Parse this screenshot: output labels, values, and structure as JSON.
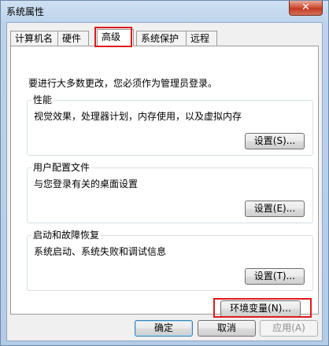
{
  "window": {
    "title": "系统属性",
    "close_glyph": "✕"
  },
  "tabs": [
    {
      "label": "计算机名"
    },
    {
      "label": "硬件"
    },
    {
      "label": "高级"
    },
    {
      "label": "系统保护"
    },
    {
      "label": "远程"
    }
  ],
  "intro": "要进行大多数更改，您必须作为管理员登录。",
  "groups": {
    "performance": {
      "title": "性能",
      "desc": "视觉效果，处理器计划，内存使用，以及虚拟内存",
      "button": "设置(S)..."
    },
    "profiles": {
      "title": "用户配置文件",
      "desc": "与您登录有关的桌面设置",
      "button": "设置(E)..."
    },
    "startup": {
      "title": "启动和故障恢复",
      "desc": "系统启动、系统失败和调试信息",
      "button": "设置(T)..."
    }
  },
  "env_button": "环境变量(N)...",
  "footer": {
    "ok": "确定",
    "cancel": "取消",
    "apply": "应用(A)"
  },
  "colors": {
    "highlight": "#e0191c",
    "close": "#c23a22"
  }
}
